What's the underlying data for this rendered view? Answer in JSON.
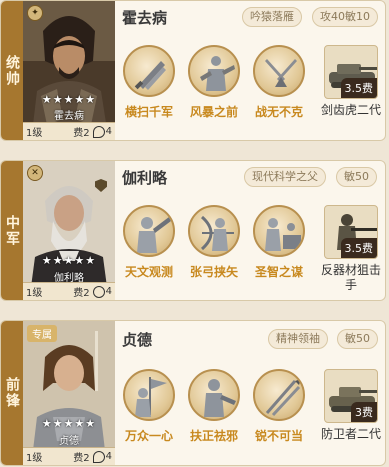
{
  "cards": [
    {
      "role": "统帅",
      "hero_name": "霍去病",
      "portrait_name": "霍去病",
      "stars": "★★★★★",
      "level": "1级",
      "cost": "费2",
      "spec_count": "4",
      "tags": [
        "吟猿落雁",
        "攻40敏10"
      ],
      "skills": [
        "横扫千军",
        "风暴之前",
        "战无不克"
      ],
      "item": {
        "name": "剑齿虎二代",
        "cost": "3.5费"
      }
    },
    {
      "role": "中军",
      "hero_name": "伽利略",
      "portrait_name": "伽利略",
      "stars": "★★★★★",
      "level": "1级",
      "cost": "费2",
      "spec_count": "4",
      "tags": [
        "现代科学之父",
        "敏50"
      ],
      "skills": [
        "天文观测",
        "张弓挟矢",
        "圣智之谋"
      ],
      "item": {
        "name": "反器材狙击手",
        "cost": "3.5费"
      }
    },
    {
      "role": "前锋",
      "badge": "专属",
      "hero_name": "贞德",
      "portrait_name": "贞德",
      "stars": "★★★★★",
      "level": "1级",
      "cost": "费2",
      "spec_count": "4",
      "tags": [
        "精神领袖",
        "敏50"
      ],
      "skills": [
        "万众一心",
        "扶正祛邪",
        "锐不可当"
      ],
      "item": {
        "name": "防卫者二代",
        "cost": "3费"
      }
    }
  ]
}
